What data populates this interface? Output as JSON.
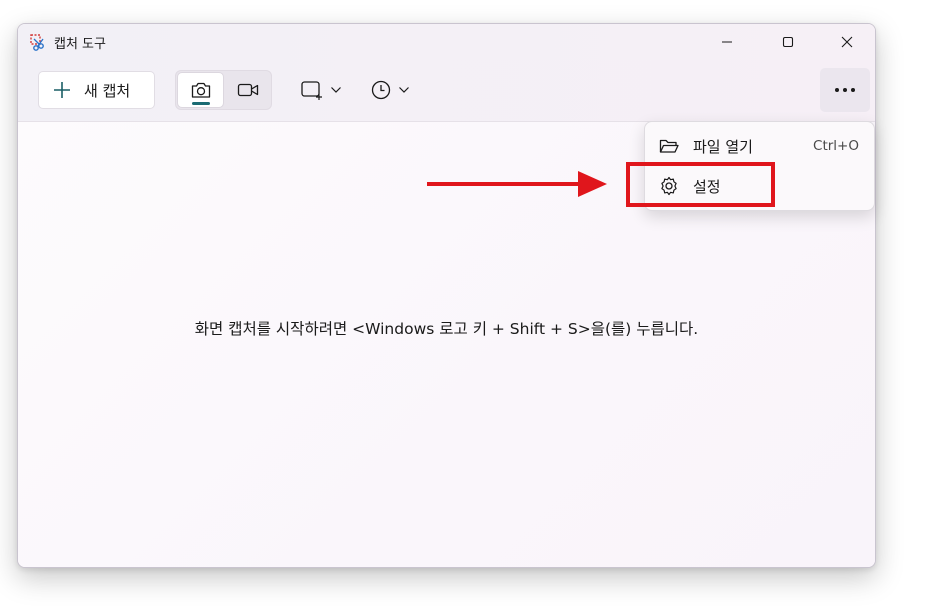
{
  "window": {
    "title": "캡처 도구",
    "controls": {
      "minimize": "minimize-icon",
      "maximize": "maximize-icon",
      "close": "close-icon"
    }
  },
  "toolbar": {
    "new_capture_label": "새 캡처",
    "modes": [
      "camera-icon",
      "video-camera-icon"
    ],
    "active_mode": "camera-icon",
    "shape_dropdown_icon": "rectangle-snip-icon",
    "timer_dropdown_icon": "clock-icon",
    "more_icon": "more-icon"
  },
  "content": {
    "hint": "화면 캡처를 시작하려면 <Windows 로고 키 + Shift + S>을(를) 누릅니다."
  },
  "menu": {
    "items": [
      {
        "label": "파일 열기",
        "shortcut": "Ctrl+O",
        "icon": "folder-open-icon"
      },
      {
        "label": "설정",
        "shortcut": "",
        "icon": "gear-icon"
      }
    ]
  },
  "annotation": {
    "color": "#e0161c",
    "target": "설정"
  },
  "colors": {
    "accent": "#1a6b73",
    "annotation_red": "#e0161c"
  }
}
